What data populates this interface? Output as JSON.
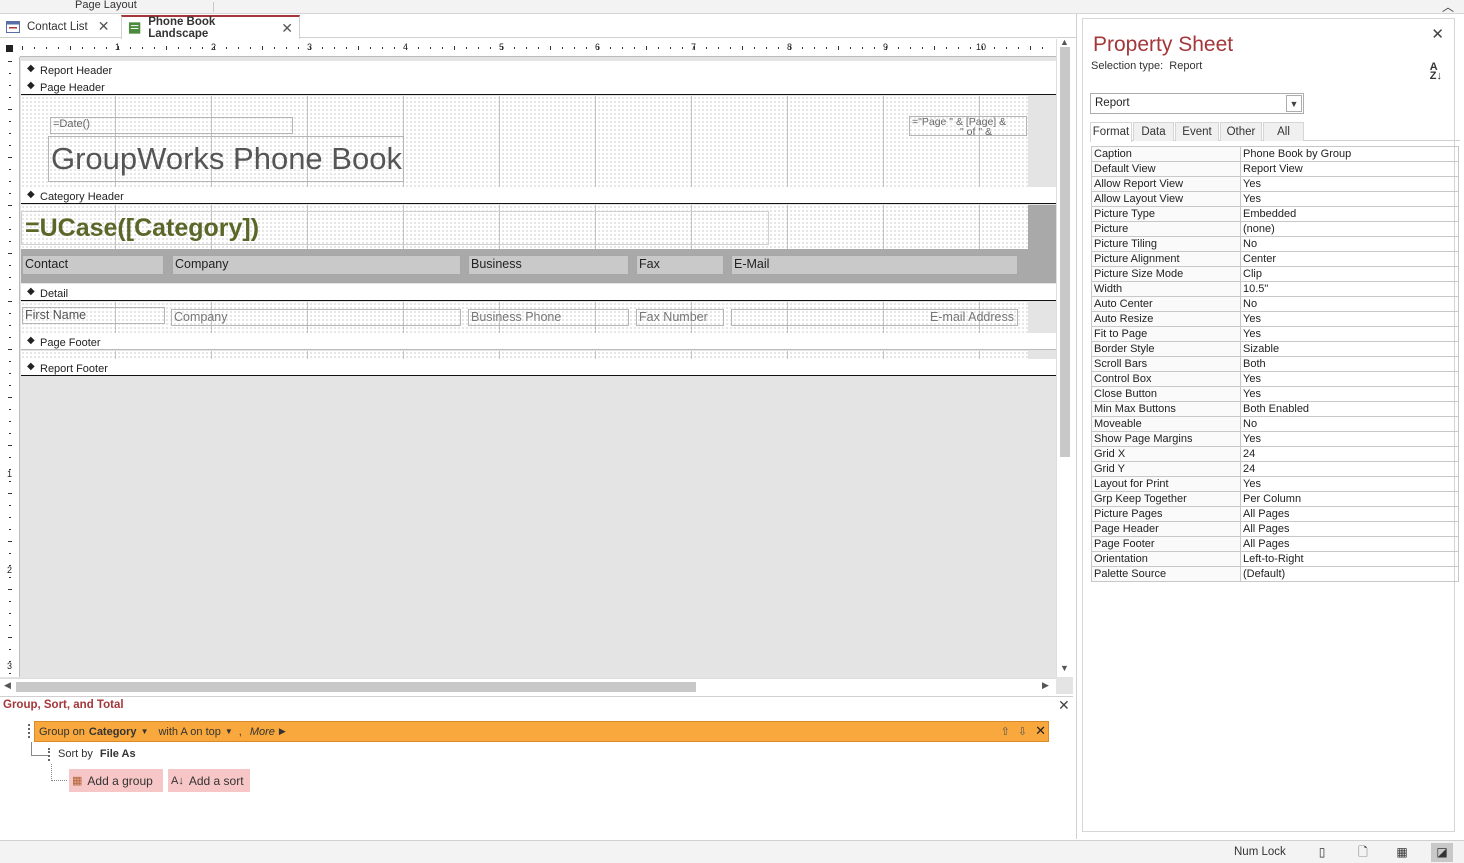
{
  "ribbon": {
    "tab_label": "Page Layout"
  },
  "tabs": [
    {
      "label": "Contact List",
      "active": false
    },
    {
      "label": "Phone Book Landscape",
      "active": true
    }
  ],
  "ruler": {
    "top_numbers": [
      "1",
      "2",
      "3",
      "4",
      "5",
      "6",
      "7",
      "8",
      "9",
      "10"
    ],
    "left_numbers": [
      "1",
      "2",
      "3"
    ]
  },
  "sections": {
    "report_header": "Report Header",
    "page_header": "Page Header",
    "category_header": "Category Header",
    "detail": "Detail",
    "page_footer": "Page Footer",
    "report_footer": "Report Footer"
  },
  "controls": {
    "date": "=Date()",
    "title": "GroupWorks Phone Book",
    "page_expr": "=\"Page \" & [Page] &",
    "page_expr_2": "\" of \" & [Pages]",
    "category": "=UCase([Category])",
    "labels": [
      "Contact",
      "Company",
      "Business",
      "Fax",
      "E-Mail"
    ],
    "fields": [
      "First Name",
      "Company",
      "Business Phone",
      "Fax Number",
      "E-mail Address"
    ]
  },
  "group_pane": {
    "title": "Group, Sort, and Total",
    "group_on_prefix": "Group on",
    "group_field": "Category",
    "order": "with A on top",
    "more": "More",
    "more_arrow": "▶",
    "sort_prefix": "Sort by",
    "sort_field": "File As",
    "add_group": "Add a group",
    "add_sort": "Add a sort"
  },
  "property_sheet": {
    "title": "Property Sheet",
    "selection_type_label": "Selection type:",
    "selection_type_value": "Report",
    "object": "Report",
    "tabs": [
      "Format",
      "Data",
      "Event",
      "Other",
      "All"
    ],
    "active_tab": "Format",
    "properties": [
      [
        "Caption",
        "Phone Book by Group"
      ],
      [
        "Default View",
        "Report View"
      ],
      [
        "Allow Report View",
        "Yes"
      ],
      [
        "Allow Layout View",
        "Yes"
      ],
      [
        "Picture Type",
        "Embedded"
      ],
      [
        "Picture",
        "(none)"
      ],
      [
        "Picture Tiling",
        "No"
      ],
      [
        "Picture Alignment",
        "Center"
      ],
      [
        "Picture Size Mode",
        "Clip"
      ],
      [
        "Width",
        "10.5\""
      ],
      [
        "Auto Center",
        "No"
      ],
      [
        "Auto Resize",
        "Yes"
      ],
      [
        "Fit to Page",
        "Yes"
      ],
      [
        "Border Style",
        "Sizable"
      ],
      [
        "Scroll Bars",
        "Both"
      ],
      [
        "Control Box",
        "Yes"
      ],
      [
        "Close Button",
        "Yes"
      ],
      [
        "Min Max Buttons",
        "Both Enabled"
      ],
      [
        "Moveable",
        "No"
      ],
      [
        "Show Page Margins",
        "Yes"
      ],
      [
        "Grid X",
        "24"
      ],
      [
        "Grid Y",
        "24"
      ],
      [
        "Layout for Print",
        "Yes"
      ],
      [
        "Grp Keep Together",
        "Per Column"
      ],
      [
        "Picture Pages",
        "All Pages"
      ],
      [
        "Page Header",
        "All Pages"
      ],
      [
        "Page Footer",
        "All Pages"
      ],
      [
        "Orientation",
        "Left-to-Right"
      ],
      [
        "Palette Source",
        "(Default)"
      ]
    ]
  },
  "status": {
    "num_lock": "Num Lock"
  },
  "colors": {
    "accent": "#a4373a",
    "group_row": "#f9a83d",
    "category_text": "#5b6728",
    "add_button": "#f7c6c6"
  }
}
